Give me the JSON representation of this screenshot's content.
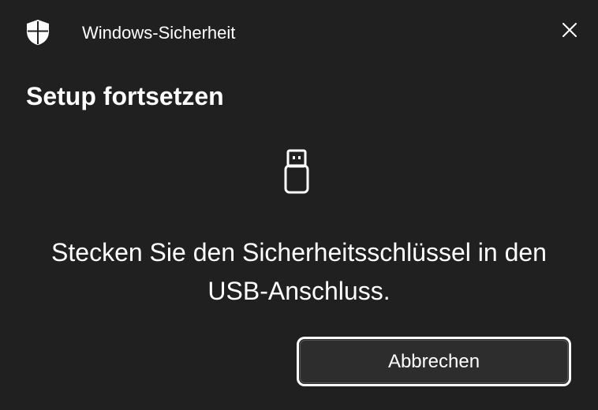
{
  "window": {
    "title": "Windows-Sicherheit",
    "app_icon": "shield-icon",
    "close_icon": "close-icon"
  },
  "dialog": {
    "heading": "Setup fortsetzen",
    "illustration_icon": "usb-key-icon",
    "message_line1": "Stecken Sie den Sicherheitsschlüssel in den",
    "message_line2": "USB-Anschluss.",
    "cancel_label": "Abbrechen"
  },
  "colors": {
    "background": "#202020",
    "text": "#ffffff",
    "button_background": "#2d2d2d",
    "button_border": "#ffffff"
  }
}
